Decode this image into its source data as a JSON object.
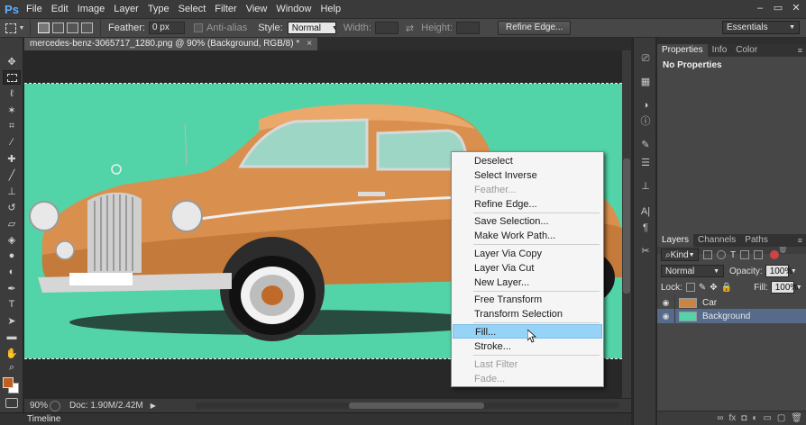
{
  "app": {
    "logo": "Ps"
  },
  "menubar": {
    "items": [
      "File",
      "Edit",
      "Image",
      "Layer",
      "Type",
      "Select",
      "Filter",
      "View",
      "Window",
      "Help"
    ]
  },
  "options": {
    "feather_label": "Feather:",
    "feather_value": "0 px",
    "antialias_label": "Anti-alias",
    "style_label": "Style:",
    "style_value": "Normal",
    "width_label": "Width:",
    "height_label": "Height:",
    "refine_edge_button": "Refine Edge...",
    "workspace": "Essentials"
  },
  "document": {
    "tab_title": "mercedes-benz-3065717_1280.png @ 90% (Background, RGB/8) *",
    "tab_close": "×",
    "canvas_color": "#52d4a8"
  },
  "status": {
    "zoom": "90%",
    "doc_info": "Doc: 1.90M/2.42M"
  },
  "timeline_label": "Timeline",
  "properties_panel": {
    "tabs": [
      "Properties",
      "Info",
      "Color"
    ],
    "body_text": "No Properties"
  },
  "layers_panel": {
    "tabs": [
      "Layers",
      "Channels",
      "Paths"
    ],
    "kind_filter": "Kind",
    "blend_mode": "Normal",
    "opacity_label": "Opacity:",
    "opacity_value": "100%",
    "lock_label": "Lock:",
    "fill_label": "Fill:",
    "fill_value": "100%",
    "layers": [
      {
        "name": "Car",
        "selected": false
      },
      {
        "name": "Background",
        "selected": true
      }
    ]
  },
  "context_menu": {
    "items": [
      {
        "label": "Deselect",
        "disabled": false
      },
      {
        "label": "Select Inverse",
        "disabled": false
      },
      {
        "label": "Feather...",
        "disabled": true
      },
      {
        "label": "Refine Edge...",
        "disabled": false
      },
      {
        "label": "Save Selection...",
        "disabled": false
      },
      {
        "label": "Make Work Path...",
        "disabled": false
      },
      {
        "label": "Layer Via Copy",
        "disabled": false
      },
      {
        "label": "Layer Via Cut",
        "disabled": false
      },
      {
        "label": "New Layer...",
        "disabled": false
      },
      {
        "label": "Free Transform",
        "disabled": false
      },
      {
        "label": "Transform Selection",
        "disabled": false
      },
      {
        "label": "Fill...",
        "disabled": false,
        "highlighted": true
      },
      {
        "label": "Stroke...",
        "disabled": false
      },
      {
        "label": "Last Filter",
        "disabled": true
      },
      {
        "label": "Fade...",
        "disabled": true
      }
    ]
  },
  "colors": {
    "foreground": "#c06020",
    "background": "#ffffff",
    "accent_highlight": "#97d3f7"
  }
}
